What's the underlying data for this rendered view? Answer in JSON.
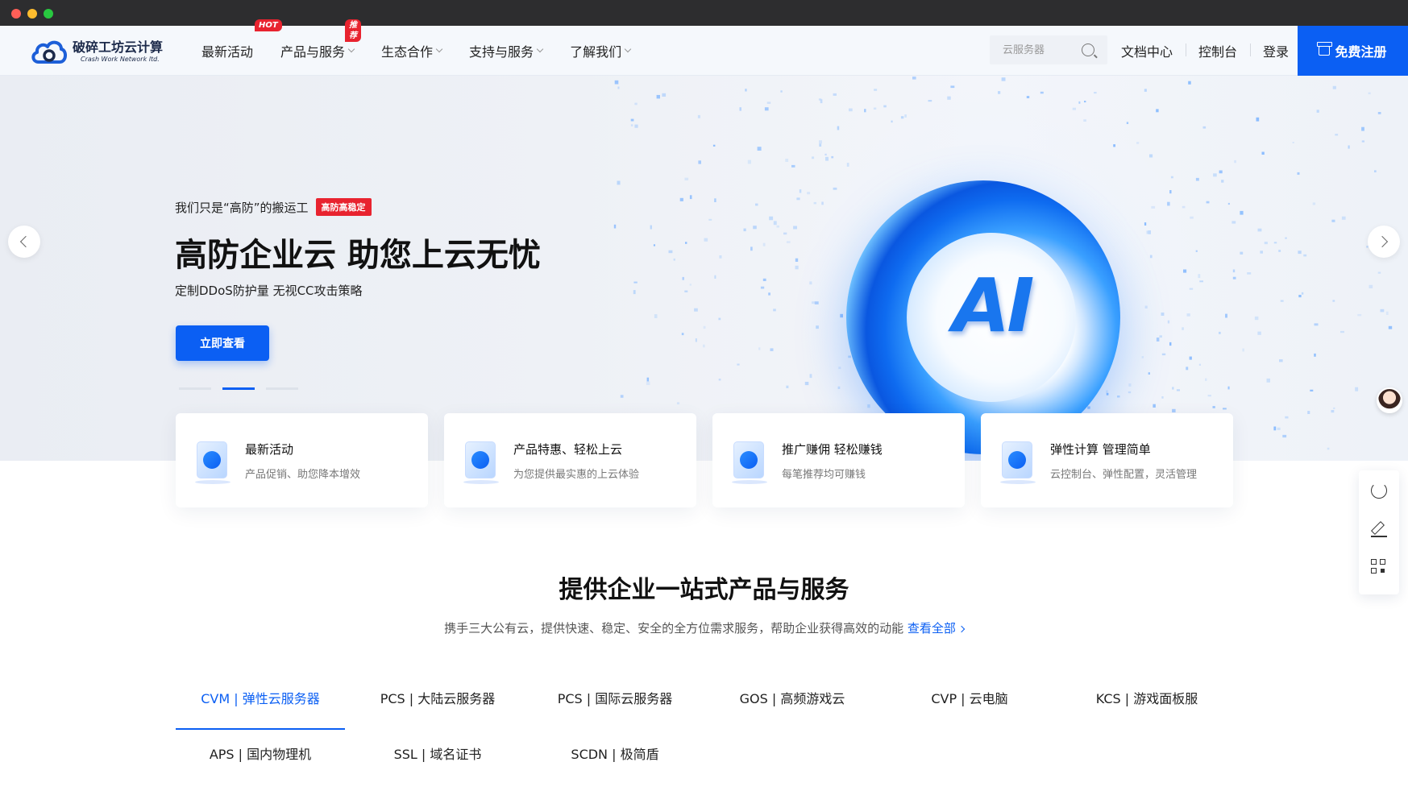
{
  "nav": {
    "logo_cn": "破碎工坊云计算",
    "logo_en": "Crash Work Network ltd.",
    "menu": [
      {
        "label": "最新活动",
        "badge": "HOT",
        "caret": false
      },
      {
        "label": "产品与服务",
        "badge": "推荐",
        "caret": true
      },
      {
        "label": "生态合作",
        "badge": "",
        "caret": true
      },
      {
        "label": "支持与服务",
        "badge": "",
        "caret": true
      },
      {
        "label": "了解我们",
        "badge": "",
        "caret": true
      }
    ],
    "search_placeholder": "云服务器",
    "links": [
      "文档中心",
      "控制台",
      "登录"
    ],
    "register": "免费注册",
    "colors": {
      "brand": "#0b5ff3",
      "badge": "#e8232f"
    }
  },
  "hero": {
    "tagline": "我们只是“高防”的搬运工",
    "tag_badge": "高防高稳定",
    "title": "高防企业云 助您上云无忧",
    "subtitle": "定制DDoS防护量 无视CC攻击策略",
    "cta": "立即查看",
    "visual_text": "AI",
    "slides_total": 3,
    "active_slide": 2
  },
  "features": [
    {
      "title": "最新活动",
      "desc": "产品促销、助您降本增效",
      "icon": "activity-icon"
    },
    {
      "title": "产品特惠、轻松上云",
      "desc": "为您提供最实惠的上云体验",
      "icon": "product-icon"
    },
    {
      "title": "推广赚佣 轻松赚钱",
      "desc": "每笔推荐均可赚钱",
      "icon": "commission-icon"
    },
    {
      "title": "弹性计算 管理简单",
      "desc": "云控制台、弹性配置，灵活管理",
      "icon": "compute-icon"
    }
  ],
  "section": {
    "title": "提供企业一站式产品与服务",
    "subtitle": "携手三大公有云，提供快速、稳定、安全的全方位需求服务，帮助企业获得高效的动能",
    "view_all": "查看全部"
  },
  "tabs": [
    {
      "label": "CVM | 弹性云服务器",
      "active": true
    },
    {
      "label": "PCS | 大陆云服务器",
      "active": false
    },
    {
      "label": "PCS | 国际云服务器",
      "active": false
    },
    {
      "label": "GOS | 高频游戏云",
      "active": false
    },
    {
      "label": "CVP | 云电脑",
      "active": false
    },
    {
      "label": "KCS | 游戏面板服",
      "active": false
    },
    {
      "label": "APS | 国内物理机",
      "active": false
    },
    {
      "label": "SSL | 域名证书",
      "active": false
    },
    {
      "label": "SCDN | 极简盾",
      "active": false
    }
  ],
  "side_tools": [
    "refresh-icon",
    "edit-icon",
    "qrcode-icon"
  ]
}
